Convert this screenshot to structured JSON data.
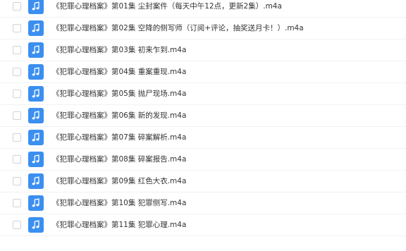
{
  "colors": {
    "icon_bg": "#3b8ff0",
    "text": "#333333",
    "row_divider": "#f1f2f4"
  },
  "file_icon": "music-note-icon",
  "files": [
    {
      "name": "《犯罪心理档案》第01集 尘封案件（每天中午12点，更新2集）.m4a"
    },
    {
      "name": "《犯罪心理档案》第02集 空降的侧写师（订阅+评论，抽奖送月卡！）.m4a"
    },
    {
      "name": "《犯罪心理档案》第03集 初来乍到.m4a"
    },
    {
      "name": "《犯罪心理档案》第04集 重案重现.m4a"
    },
    {
      "name": "《犯罪心理档案》第05集 抛尸现场.m4a"
    },
    {
      "name": "《犯罪心理档案》第06集 新的发现.m4a"
    },
    {
      "name": "《犯罪心理档案》第07集 碎案解析.m4a"
    },
    {
      "name": "《犯罪心理档案》第08集 碎案报告.m4a"
    },
    {
      "name": "《犯罪心理档案》第09集 红色大衣.m4a"
    },
    {
      "name": "《犯罪心理档案》第10集 犯罪侧写.m4a"
    },
    {
      "name": "《犯罪心理档案》第11集 犯罪心理.m4a"
    }
  ]
}
